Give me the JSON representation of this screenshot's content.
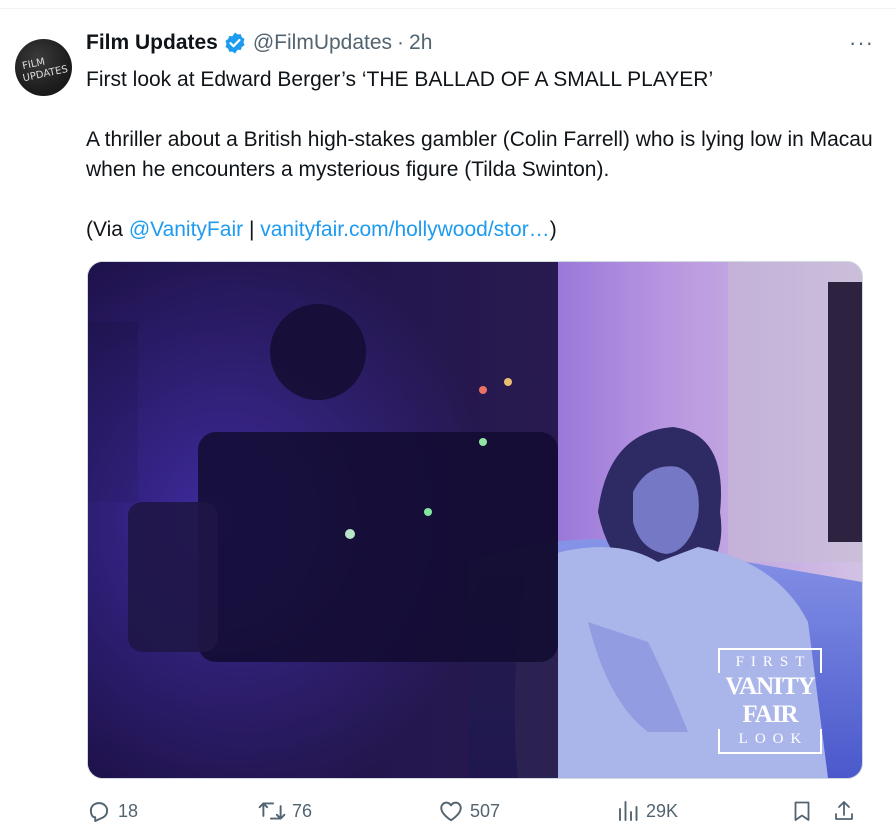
{
  "tweet": {
    "author_name": "Film Updates",
    "handle": "@FilmUpdates",
    "separator": "·",
    "time": "2h",
    "more_label": "···",
    "avatar_text": [
      "FILM",
      "UPDATES"
    ],
    "line1": "First look at Edward Berger’s ‘THE BALLAD OF A SMALL PLAYER’",
    "line2": "A thriller about a British high-stakes gambler (Colin Farrell) who is lying low in Macau when he encounters a mysterious figure (Tilda Swinton).",
    "via_prefix": "(Via ",
    "via_mention": "@VanityFair",
    "via_sep": " | ",
    "via_link": "vanityfair.com/hollywood/stor…",
    "via_suffix": ")"
  },
  "media": {
    "badge_top": "FIRST",
    "badge_main": "VANITY FAIR",
    "badge_bottom": "LOOK"
  },
  "actions": {
    "replies": "18",
    "reposts": "76",
    "likes": "507",
    "views": "29K"
  },
  "colors": {
    "link": "#1d9bf0",
    "muted": "#536471",
    "verified": "#1d9bf0"
  },
  "icons": [
    "verified-badge-icon",
    "more-icon",
    "reply-icon",
    "repost-icon",
    "like-icon",
    "views-icon",
    "bookmark-icon",
    "share-icon"
  ]
}
